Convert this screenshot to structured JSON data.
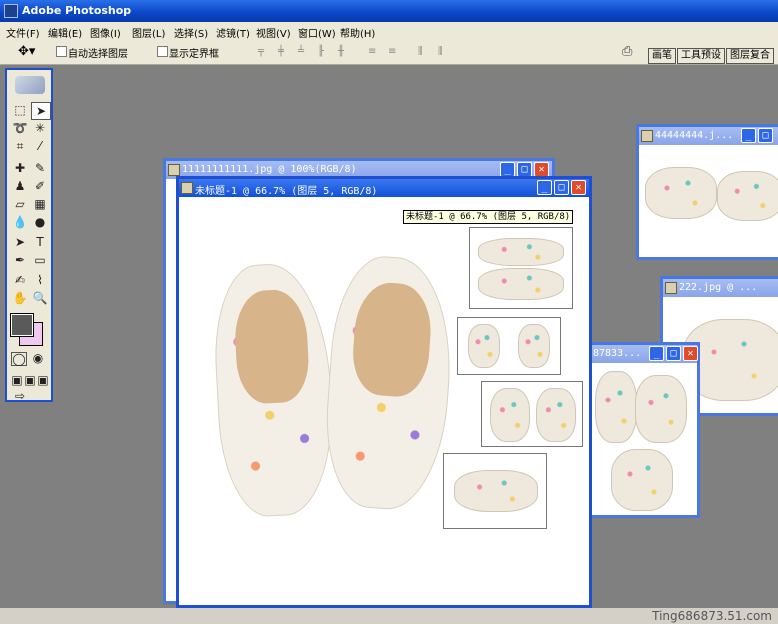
{
  "app": {
    "title": "Adobe Photoshop"
  },
  "menu": [
    "文件(F)",
    "编辑(E)",
    "图像(I)",
    "图层(L)",
    "选择(S)",
    "滤镜(T)",
    "视图(V)",
    "窗口(W)",
    "帮助(H)"
  ],
  "options": {
    "auto_select": "自动选择图层",
    "show_bounds": "显示定界框"
  },
  "palette_tabs": [
    "画笔",
    "工具预设",
    "图层复合"
  ],
  "windows": {
    "w1": "11111111111.jpg @ 100%(RGB/8)",
    "main": "未标题-1 @ 66.7% (图层 5, RGB/8)",
    "w4": "44444444.j...",
    "w2": "222.jpg @ ...",
    "w8": "87833..."
  },
  "tooltip": "未标题-1 @ 66.7% (图层 5, RGB/8)",
  "watermark": "Ting686873.51.com",
  "colors": {
    "title_blue": "#0a47c8",
    "foreground": "#5a5a5a",
    "background": "#f0c8f0"
  }
}
